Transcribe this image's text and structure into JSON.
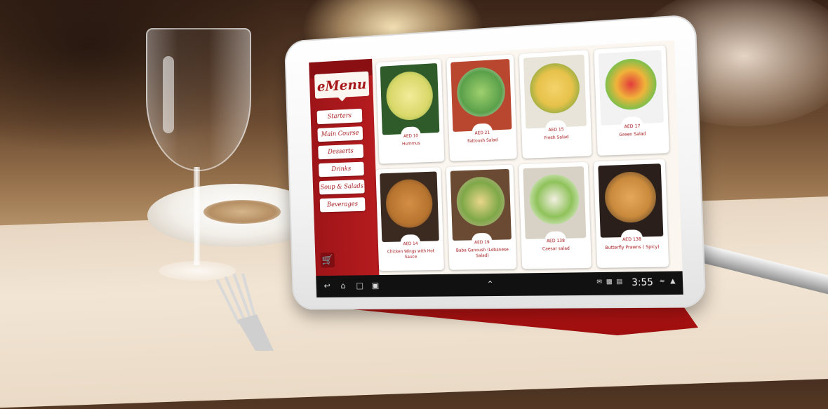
{
  "brand": {
    "title": "eMenu"
  },
  "menu": {
    "categories": [
      "Starters",
      "Main Course",
      "Desserts",
      "Drinks",
      "Soup & Salads",
      "Beverages"
    ]
  },
  "dishes": [
    {
      "price": "AED 10",
      "name": "Hummus",
      "color": "#d9d86a"
    },
    {
      "price": "AED 21",
      "name": "Fattoush Salad",
      "color": "#5aa04a"
    },
    {
      "price": "AED 15",
      "name": "Fresh Salad",
      "color": "#e6c24a"
    },
    {
      "price": "AED 17",
      "name": "Green Salad",
      "color": "#7fbf4a"
    },
    {
      "price": "AED 14",
      "name": "Chicken Wings with Hot Sauce",
      "color": "#b7742f"
    },
    {
      "price": "AED 19",
      "name": "Baba Ganoush (Lebanese Salad)",
      "color": "#7ea848"
    },
    {
      "price": "AED 138",
      "name": "Caesar salad",
      "color": "#8fc25a"
    },
    {
      "price": "AED 138",
      "name": "Butterfly Prawns ( Spicy)",
      "color": "#c98a3c"
    }
  ],
  "statusbar": {
    "clock": "3:55"
  },
  "icons": {
    "back": "back-icon",
    "home": "home-icon",
    "recent": "recent-apps-icon",
    "screenshot": "screenshot-icon",
    "up": "chevron-up-icon",
    "cart": "cart-icon"
  },
  "colors": {
    "accent": "#a5161a",
    "cover": "#d11a1a"
  }
}
